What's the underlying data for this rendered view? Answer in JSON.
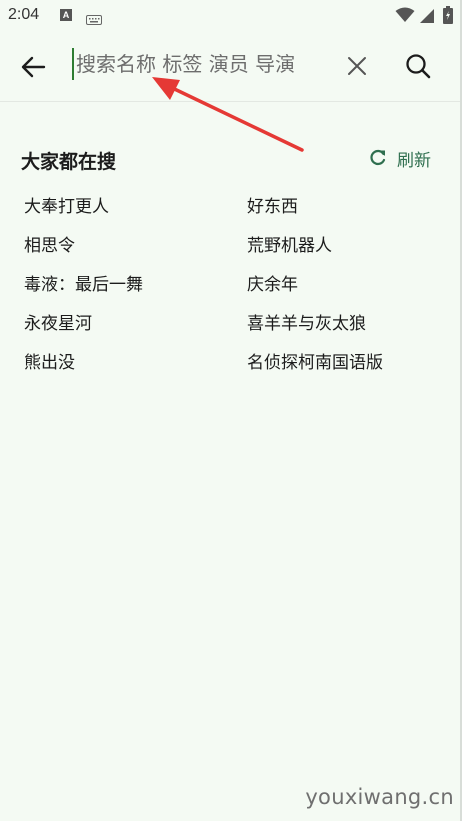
{
  "status_bar": {
    "time": "2:04",
    "icons": [
      "text-a-icon",
      "keyboard-icon",
      "wifi-icon",
      "signal-icon",
      "battery-icon"
    ]
  },
  "search": {
    "placeholder": "搜索名称 标签 演员 导演",
    "value": ""
  },
  "hot_search": {
    "title": "大家都在搜",
    "refresh_label": "刷新",
    "items": [
      "大奉打更人",
      "好东西",
      "相思令",
      "荒野机器人",
      "毒液：最后一舞",
      "庆余年",
      "永夜星河",
      "喜羊羊与灰太狼",
      "熊出没",
      "名侦探柯南国语版"
    ]
  },
  "watermark": "youxiwang.cn",
  "colors": {
    "background": "#f4faf3",
    "accent_green": "#2f6f4f",
    "annotation_red": "#e53935",
    "text": "#1c1c1c"
  }
}
